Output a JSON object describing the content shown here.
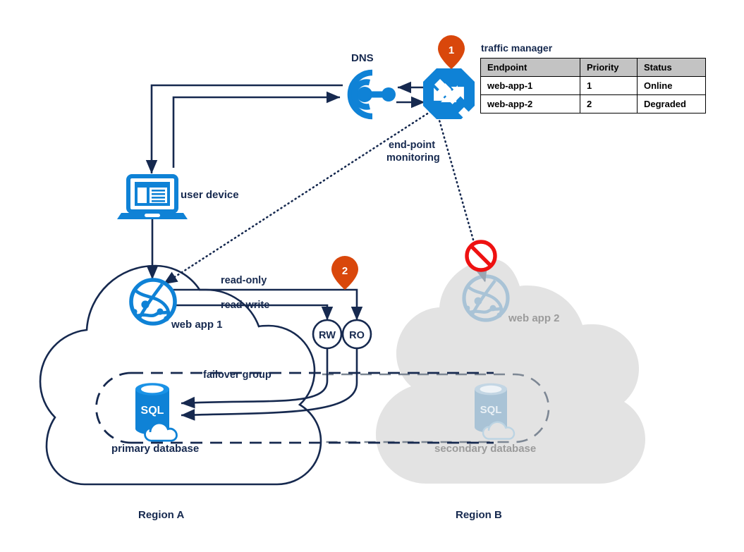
{
  "diagram": {
    "title": "Azure multi-region web app failover architecture",
    "colors": {
      "azure_blue": "#0f82d6",
      "dark_navy": "#16294f",
      "pin_orange": "#d9470b",
      "online_green": "#00b33c",
      "degraded_red": "#d40000",
      "disabled_grey": "#e3e3e3",
      "disabled_icon": "#a9c3d6",
      "disabled_text": "#9b9b9b",
      "table_header_grey": "#c3c3c3"
    }
  },
  "traffic_manager": {
    "title": "traffic manager",
    "columns": [
      "Endpoint",
      "Priority",
      "Status"
    ],
    "rows": [
      {
        "endpoint": "web-app-1",
        "priority": "1",
        "status": "Online",
        "status_state": "online"
      },
      {
        "endpoint": "web-app-2",
        "priority": "2",
        "status": "Degraded",
        "status_state": "degraded"
      }
    ]
  },
  "markers": [
    {
      "id": "marker-1",
      "number": "1"
    },
    {
      "id": "marker-2",
      "number": "2"
    }
  ],
  "nodes": {
    "dns": "DNS",
    "user_device": "user device",
    "web_app_1": "web app 1",
    "web_app_2": "web app 2",
    "primary_database": "primary database",
    "secondary_database": "secondary database",
    "rw": "RW",
    "ro": "RO",
    "sql_primary": "SQL",
    "sql_secondary": "SQL"
  },
  "edge_labels": {
    "endpoint_monitoring_line1": "end-point",
    "endpoint_monitoring_line2": "monitoring",
    "read_only": "read-only",
    "read_write": "read-write",
    "failover_group": "failover group"
  },
  "regions": {
    "region_a": "Region A",
    "region_b": "Region B"
  }
}
